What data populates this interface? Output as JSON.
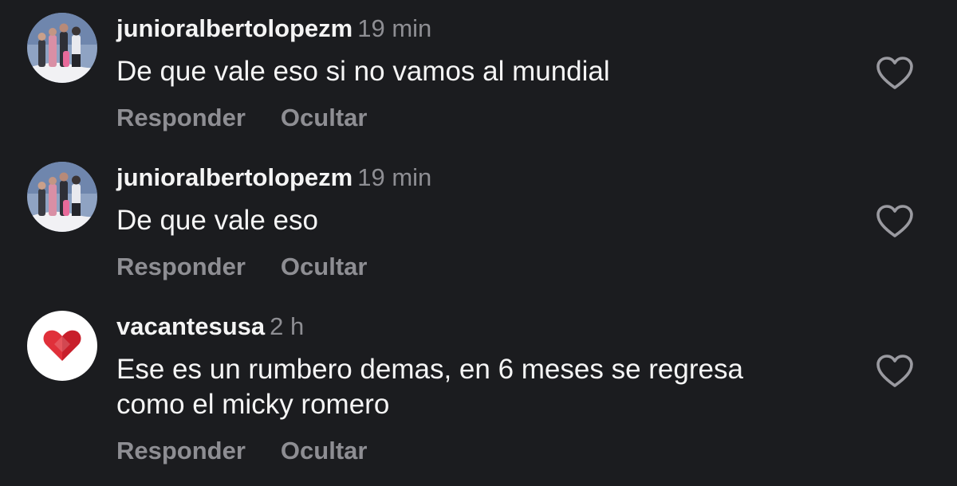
{
  "comments": [
    {
      "username": "junioralbertolopezm",
      "time": "19 min",
      "text_lines": [
        "De que vale eso si no vamos al mundial"
      ],
      "reply_label": "Responder",
      "hide_label": "Ocultar",
      "avatar_icon": "photo-avatar-icon",
      "like_icon": "heart-outline-icon"
    },
    {
      "username": "junioralbertolopezm",
      "time": "19 min",
      "text_lines": [
        "De que vale eso"
      ],
      "reply_label": "Responder",
      "hide_label": "Ocultar",
      "avatar_icon": "photo-avatar-icon",
      "like_icon": "heart-outline-icon"
    },
    {
      "username": "vacantesusa",
      "time": "2 h",
      "text_lines": [
        "Ese es un rumbero demas, en 6 meses se regresa",
        "como el micky romero"
      ],
      "reply_label": "Responder",
      "hide_label": "Ocultar",
      "avatar_icon": "red-heart-logo-icon",
      "like_icon": "heart-outline-icon"
    }
  ],
  "colors": {
    "background": "#1b1c1f",
    "text": "#f5f5f5",
    "muted": "#8e8e93",
    "brand_red": "#e0303a"
  }
}
